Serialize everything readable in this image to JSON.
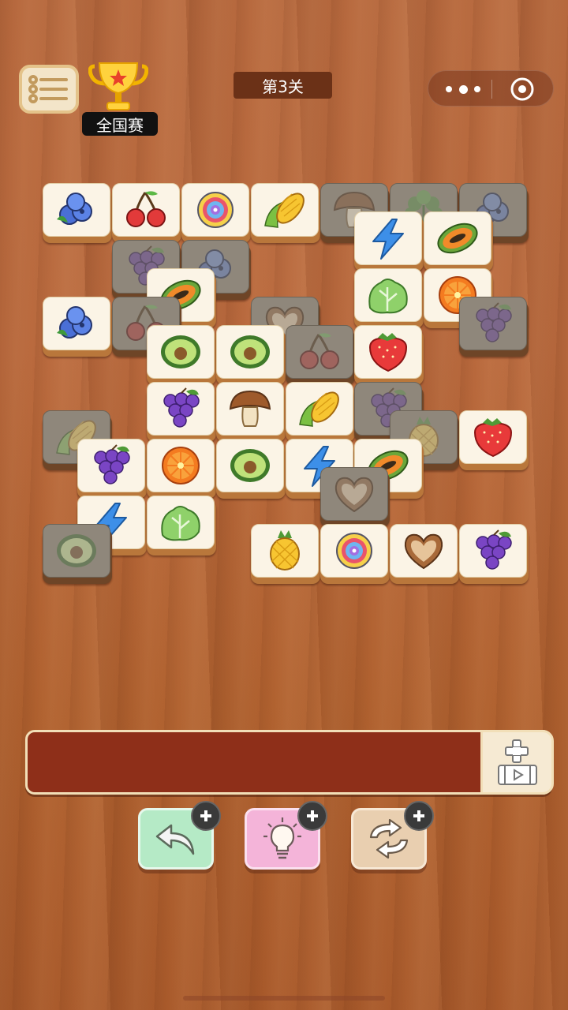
{
  "header": {
    "competition_badge": "全国赛",
    "level_title": "第3关"
  },
  "capsule": {
    "more_icon": "more-dots-icon",
    "close_icon": "target-close-icon"
  },
  "tiles": [
    {
      "type": "blueberry",
      "dim": false
    },
    {
      "type": "cherry",
      "dim": false
    },
    {
      "type": "candy",
      "dim": false
    },
    {
      "type": "corn",
      "dim": false
    },
    {
      "type": "mushroom",
      "dim": true
    },
    {
      "type": "herb",
      "dim": true
    },
    {
      "type": "blueberry",
      "dim": true
    },
    {
      "type": "grape",
      "dim": true
    },
    {
      "type": "blueberry",
      "dim": true
    },
    {
      "type": "lightning",
      "dim": false
    },
    {
      "type": "papaya",
      "dim": false
    },
    {
      "type": "papaya",
      "dim": false
    },
    {
      "type": "blueberry",
      "dim": false
    },
    {
      "type": "cherry",
      "dim": true
    },
    {
      "type": "cookie",
      "dim": true
    },
    {
      "type": "lettuce",
      "dim": false
    },
    {
      "type": "orange",
      "dim": false
    },
    {
      "type": "grape",
      "dim": true
    },
    {
      "type": "avocado",
      "dim": false
    },
    {
      "type": "avocado",
      "dim": false
    },
    {
      "type": "cherry",
      "dim": true
    },
    {
      "type": "strawberry",
      "dim": false
    },
    {
      "type": "grape",
      "dim": false
    },
    {
      "type": "mushroom",
      "dim": false
    },
    {
      "type": "corn",
      "dim": false
    },
    {
      "type": "grape",
      "dim": true
    },
    {
      "type": "corn",
      "dim": true
    },
    {
      "type": "pineapple",
      "dim": true
    },
    {
      "type": "strawberry",
      "dim": false
    },
    {
      "type": "grape",
      "dim": false
    },
    {
      "type": "orange",
      "dim": false
    },
    {
      "type": "avocado",
      "dim": false
    },
    {
      "type": "lightning",
      "dim": false
    },
    {
      "type": "papaya",
      "dim": false
    },
    {
      "type": "cookie",
      "dim": true
    },
    {
      "type": "lightning",
      "dim": false
    },
    {
      "type": "lettuce",
      "dim": false
    },
    {
      "type": "avocado",
      "dim": true
    },
    {
      "type": "pineapple",
      "dim": false
    },
    {
      "type": "candy",
      "dim": false
    },
    {
      "type": "cookie",
      "dim": false
    },
    {
      "type": "grape",
      "dim": false
    }
  ],
  "tools": [
    {
      "name": "undo",
      "icon": "undo-arrow-icon"
    },
    {
      "name": "hint",
      "icon": "lightbulb-icon"
    },
    {
      "name": "shuffle",
      "icon": "shuffle-icon"
    }
  ]
}
